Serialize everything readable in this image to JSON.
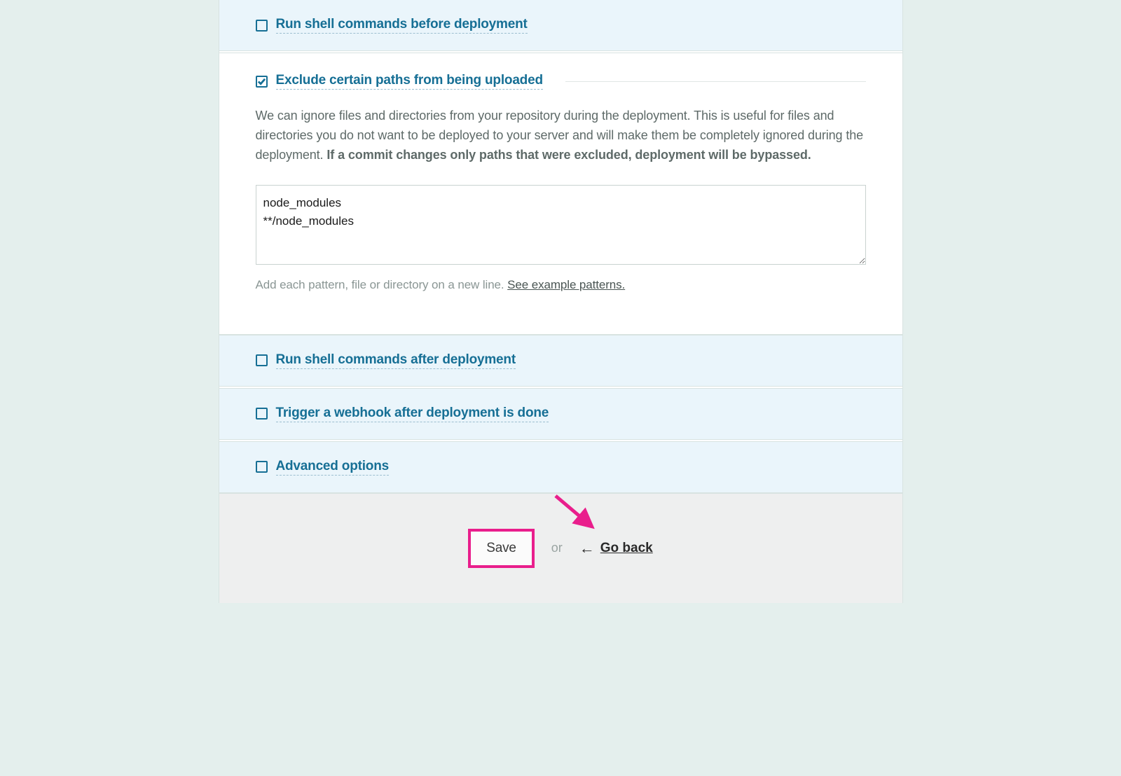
{
  "sections": {
    "pre_shell": {
      "title": "Run shell commands before deployment",
      "checked": false
    },
    "exclude_paths": {
      "title": "Exclude certain paths from being uploaded",
      "checked": true,
      "description_part1": "We can ignore files and directories from your repository during the deployment. This is useful for files and directories you do not want to be deployed to your server and will make them be completely ignored during the deployment. ",
      "description_bold": "If a commit changes only paths that were excluded, deployment will be bypassed.",
      "textarea_value": "node_modules\n**/node_modules",
      "helper_text": "Add each pattern, file or directory on a new line. ",
      "helper_link": "See example patterns."
    },
    "post_shell": {
      "title": "Run shell commands after deployment",
      "checked": false
    },
    "webhook": {
      "title": "Trigger a webhook after deployment is done",
      "checked": false
    },
    "advanced": {
      "title": "Advanced options",
      "checked": false
    }
  },
  "footer": {
    "save_label": "Save",
    "or_label": "or",
    "goback_label": "Go back"
  },
  "colors": {
    "accent": "#e91e8c",
    "link": "#166f95",
    "bg": "#e4efed",
    "panel": "#eaf5fb"
  }
}
